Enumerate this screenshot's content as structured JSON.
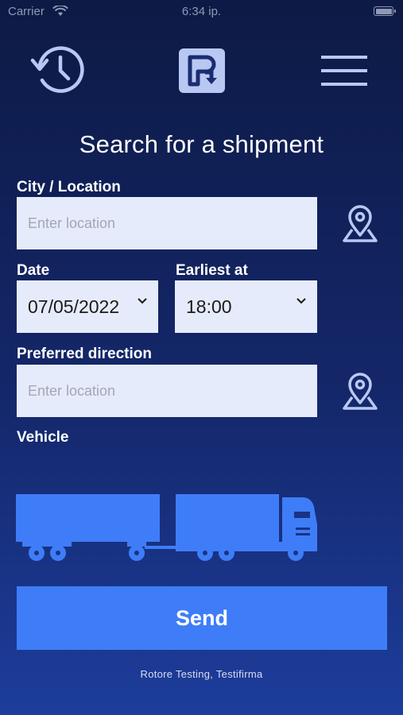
{
  "status_bar": {
    "carrier": "Carrier",
    "time": "6:34 ip."
  },
  "header": {
    "history_icon": "history-clock-icon",
    "logo_icon": "app-logo-icon",
    "menu_icon": "hamburger-menu-icon"
  },
  "page": {
    "title": "Search for a shipment"
  },
  "form": {
    "location": {
      "label": "City / Location",
      "placeholder": "Enter location",
      "value": "",
      "icon": "map-pin-icon"
    },
    "date": {
      "label": "Date",
      "value": "07/05/2022"
    },
    "earliest": {
      "label": "Earliest at",
      "value": "18:00"
    },
    "direction": {
      "label": "Preferred direction",
      "placeholder": "Enter location",
      "value": "",
      "icon": "map-pin-icon"
    },
    "vehicle": {
      "label": "Vehicle",
      "icon": "truck-trailer-icon"
    }
  },
  "send_button": {
    "label": "Send"
  },
  "footer": {
    "text": "Rotore Testing, Testifirma"
  },
  "colors": {
    "accent": "#3f7df8",
    "icon_light": "#b9c8f3",
    "input_bg": "#e6ebfb"
  }
}
